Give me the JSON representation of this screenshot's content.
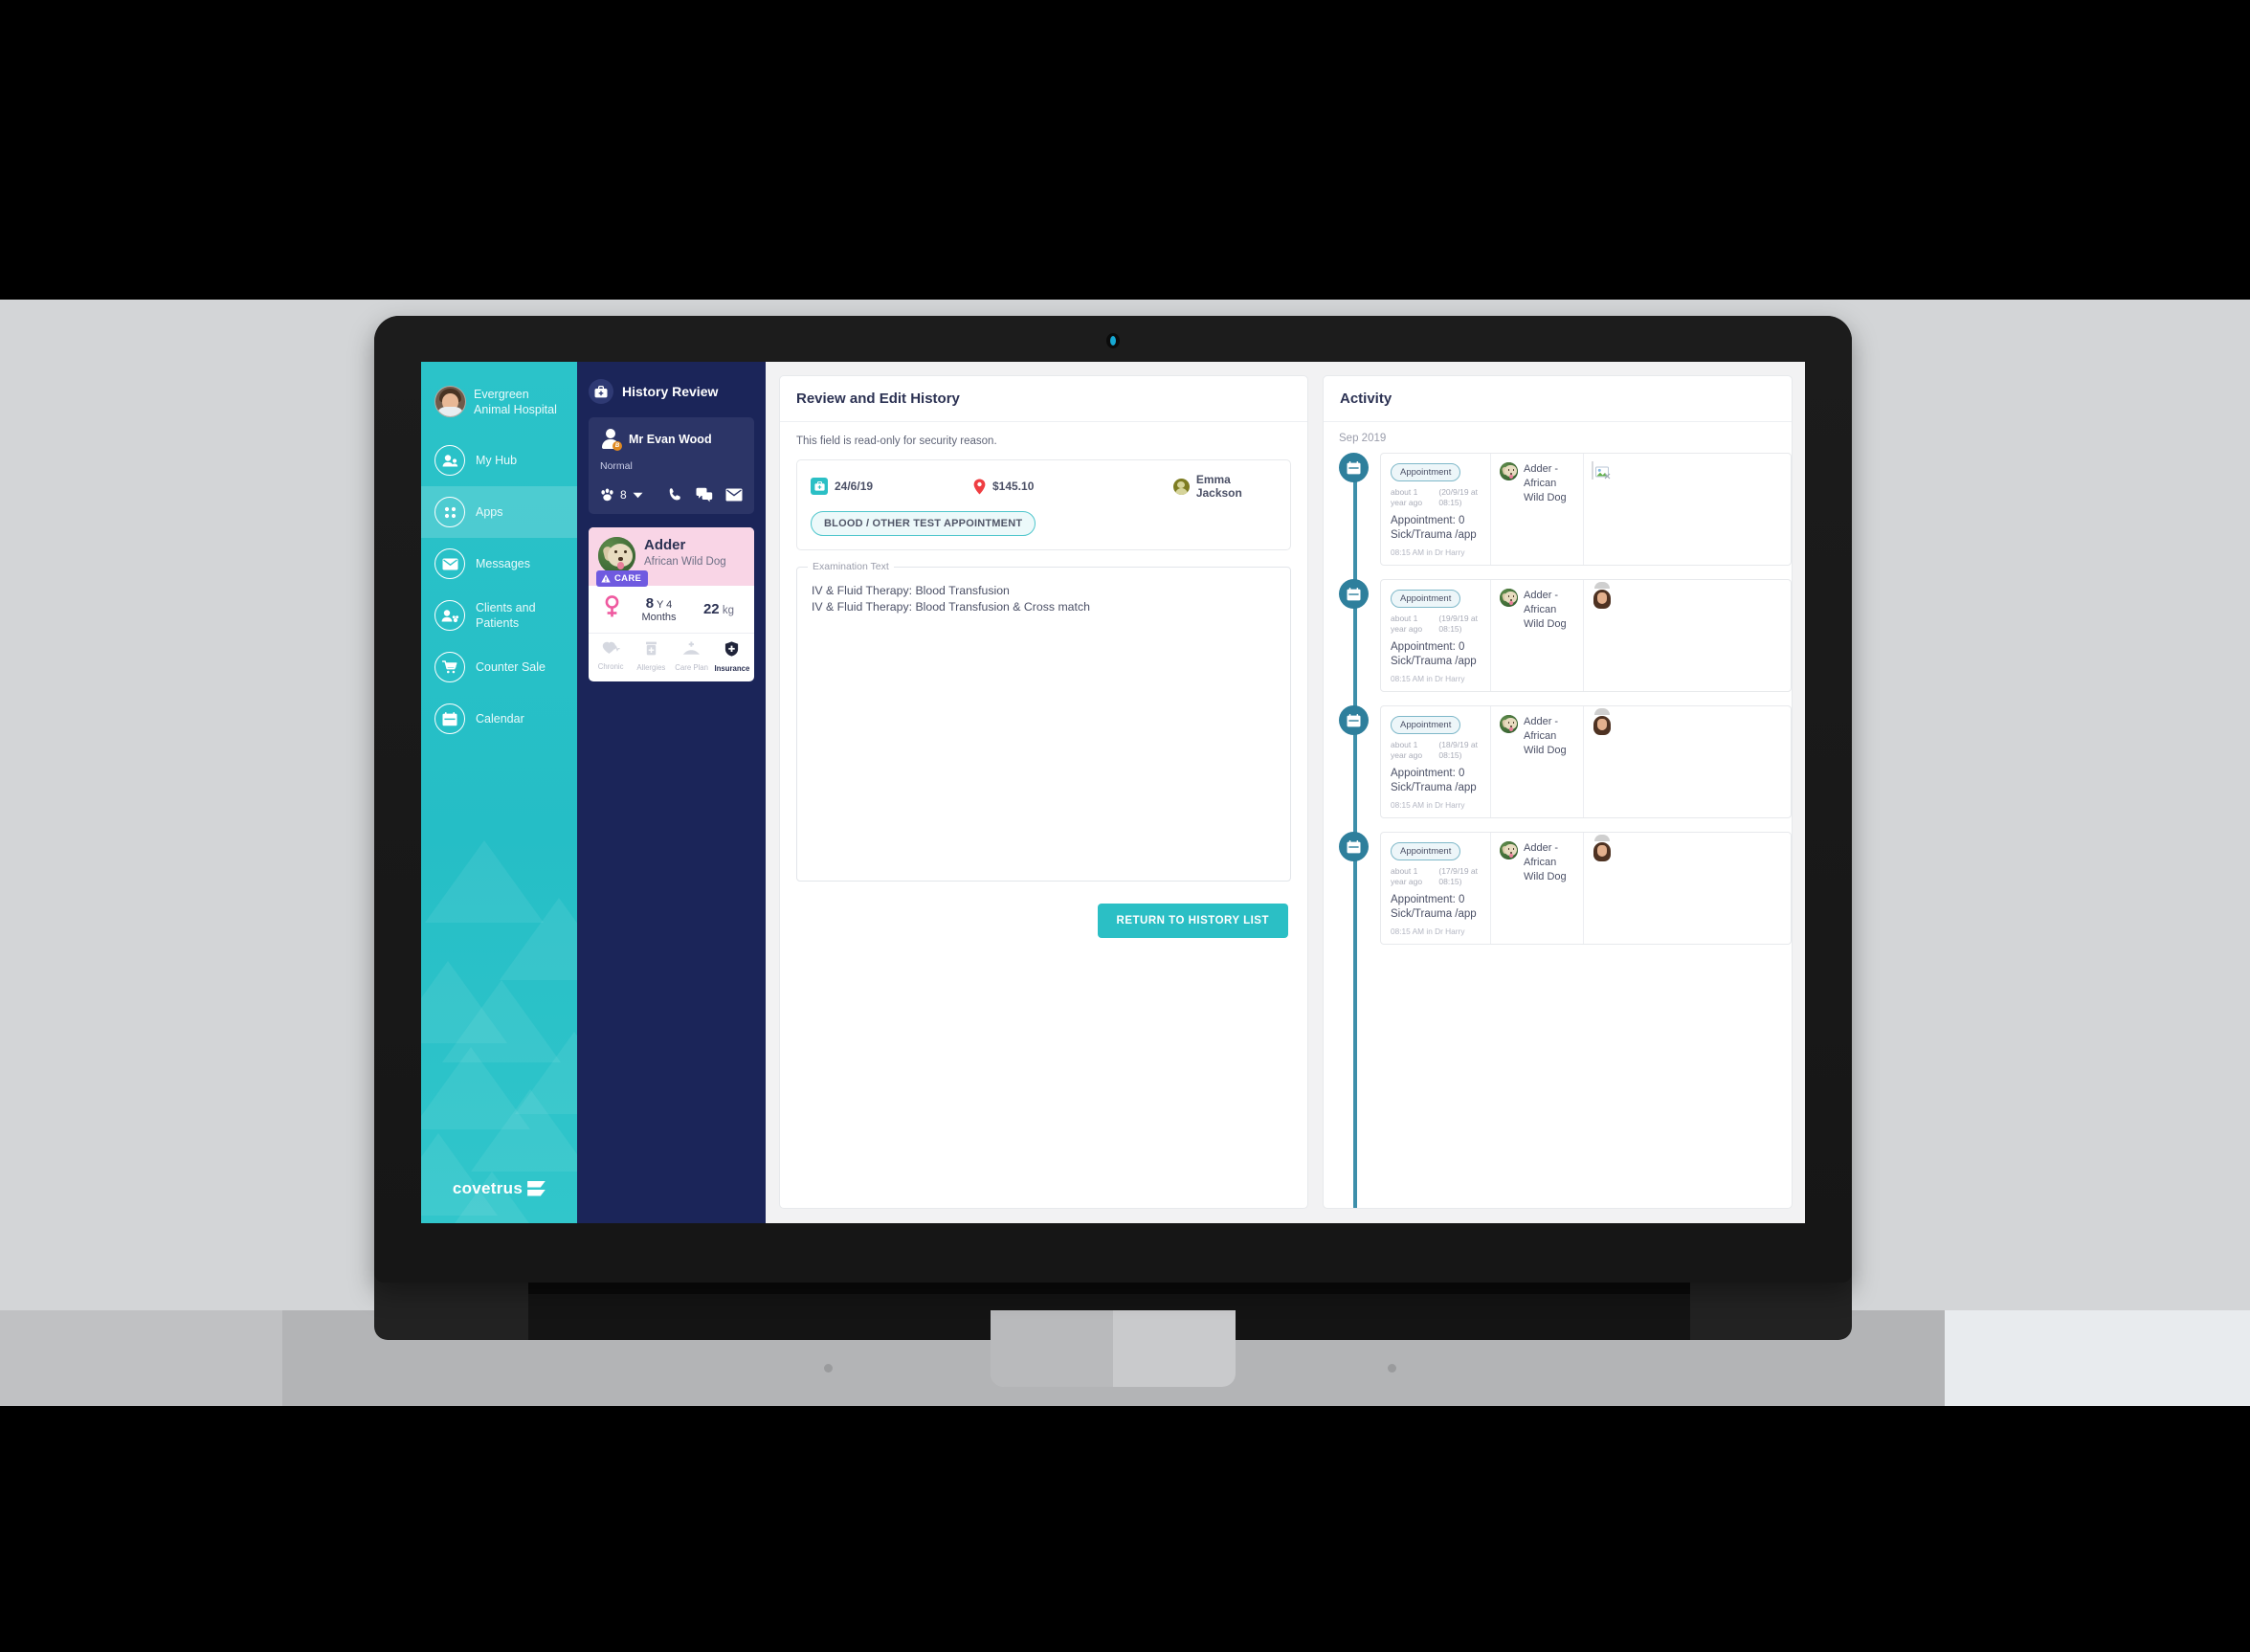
{
  "sidebar": {
    "org": {
      "name": "Evergreen Animal Hospital",
      "avatar": "user-photo-avatar"
    },
    "items": [
      {
        "label": "My Hub",
        "icon": "user-hub-icon",
        "active": false
      },
      {
        "label": "Apps",
        "icon": "apps-grid-icon",
        "active": true
      },
      {
        "label": "Messages",
        "icon": "envelope-icon",
        "active": false
      },
      {
        "label": "Clients and Patients",
        "icon": "clients-patients-icon",
        "active": false
      },
      {
        "label": "Counter Sale",
        "icon": "shopping-cart-icon",
        "active": false
      },
      {
        "label": "Calendar",
        "icon": "calendar-icon",
        "active": false
      }
    ],
    "logo": "covetrus"
  },
  "patient_panel": {
    "header": {
      "title": "History Review",
      "icon": "medical-bag-icon"
    },
    "owner": {
      "name": "Mr Evan Wood",
      "badge_letter": "B",
      "status": "Normal",
      "pet_count": "8",
      "actions": [
        "phone-icon",
        "chat-icon",
        "email-icon"
      ]
    },
    "pet": {
      "name": "Adder",
      "breed": "African Wild Dog",
      "care_badge": "CARE",
      "sex": "female",
      "age_value": "8",
      "age_unit": "Y",
      "age_months": "4 Months",
      "weight_value": "22",
      "weight_unit": "kg",
      "flags": [
        {
          "label": "Chronic",
          "icon": "heart-pulse-icon",
          "active": false
        },
        {
          "label": "Allergies",
          "icon": "pill-bottle-icon",
          "active": false
        },
        {
          "label": "Care Plan",
          "icon": "hand-care-icon",
          "active": false
        },
        {
          "label": "Insurance",
          "icon": "shield-plus-icon",
          "active": true
        }
      ]
    }
  },
  "main": {
    "title": "Review and Edit History",
    "readonly_note": "This field is read-only for security reason.",
    "visit": {
      "date": "24/6/19",
      "date_icon": "medical-bag-icon",
      "price": "$145.10",
      "price_icon": "location-pin-icon",
      "staff": "Emma Jackson",
      "staff_avatar": "staff-avatar",
      "tag": "BLOOD / OTHER TEST APPOINTMENT"
    },
    "examination": {
      "legend": "Examination Text",
      "lines": [
        "IV & Fluid Therapy: Blood Transfusion",
        "IV & Fluid Therapy: Blood Transfusion & Cross match"
      ]
    },
    "return_button": "RETURN TO HISTORY LIST"
  },
  "activity": {
    "title": "Activity",
    "month": "Sep",
    "year": "2019",
    "items": [
      {
        "chip": "Appointment",
        "relative": "about 1 year ago",
        "absolute": "(20/9/19 at 08:15)",
        "title": "Appointment: 0 Sick/Trauma /app",
        "footer": "08:15 AM in Dr Harry",
        "pet": "Adder - African Wild Dog",
        "right_icon": "broken-image-icon"
      },
      {
        "chip": "Appointment",
        "relative": "about 1 year ago",
        "absolute": "(19/9/19 at 08:15)",
        "title": "Appointment: 0 Sick/Trauma /app",
        "footer": "08:15 AM in Dr Harry",
        "pet": "Adder - African Wild Dog",
        "right_icon": "staff-photo-avatar"
      },
      {
        "chip": "Appointment",
        "relative": "about 1 year ago",
        "absolute": "(18/9/19 at 08:15)",
        "title": "Appointment: 0 Sick/Trauma /app",
        "footer": "08:15 AM in Dr Harry",
        "pet": "Adder - African Wild Dog",
        "right_icon": "staff-photo-avatar"
      },
      {
        "chip": "Appointment",
        "relative": "about 1 year ago",
        "absolute": "(17/9/19 at 08:15)",
        "title": "Appointment: 0 Sick/Trauma /app",
        "footer": "08:15 AM in Dr Harry",
        "pet": "Adder - African Wild Dog",
        "right_icon": "staff-photo-avatar"
      }
    ]
  },
  "colors": {
    "accent_teal": "#2bbfc5",
    "sidebar_teal": "#2bc3c9",
    "navy": "#1b2559",
    "card_navy": "#2c3567",
    "pet_pink": "#f9d5e6",
    "care_purple": "#6f5ae0",
    "timeline_blue": "#2e7f9c",
    "price_red": "#ef3e42"
  }
}
